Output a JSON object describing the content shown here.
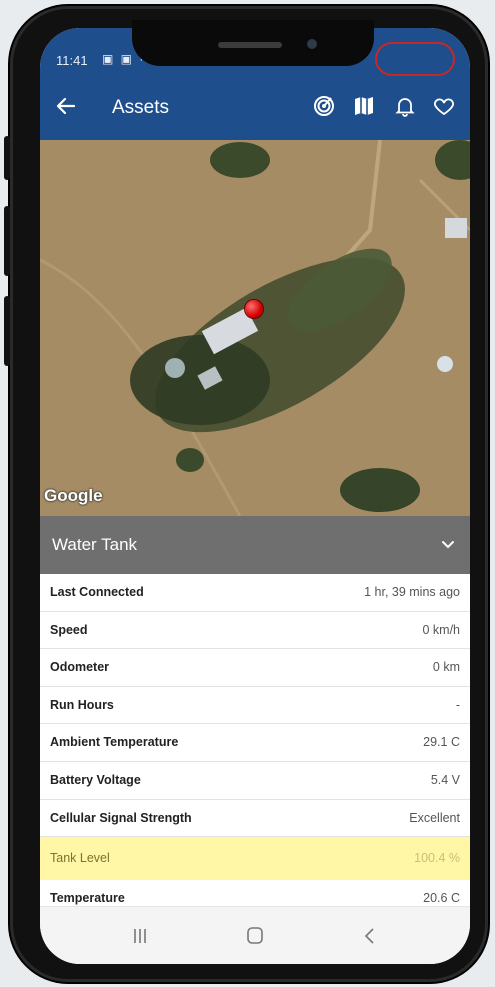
{
  "status": {
    "time": "11:41",
    "icons": "▣ ▣ ·"
  },
  "appbar": {
    "title": "Assets",
    "icons": [
      "back-arrow-icon",
      "radar-icon",
      "map-icon",
      "bell-icon",
      "heart-icon"
    ]
  },
  "map": {
    "attribution": "Google"
  },
  "section": {
    "label": "Water Tank"
  },
  "details": [
    {
      "label": "Last Connected",
      "value": "1 hr, 39 mins ago"
    },
    {
      "label": "Speed",
      "value": "0 km/h"
    },
    {
      "label": "Odometer",
      "value": "0 km"
    },
    {
      "label": "Run Hours",
      "value": "-"
    },
    {
      "label": "Ambient Temperature",
      "value": "29.1 C"
    },
    {
      "label": "Battery Voltage",
      "value": "5.4 V"
    },
    {
      "label": "Cellular Signal Strength",
      "value": "Excellent"
    },
    {
      "label": "Tank Level",
      "value": "100.4 %"
    },
    {
      "label": "Temperature",
      "value": "20.6 C"
    }
  ],
  "colors": {
    "appbar": "#1f4e8c",
    "section": "#6f6f6f",
    "highlight": "#fff6a6"
  }
}
